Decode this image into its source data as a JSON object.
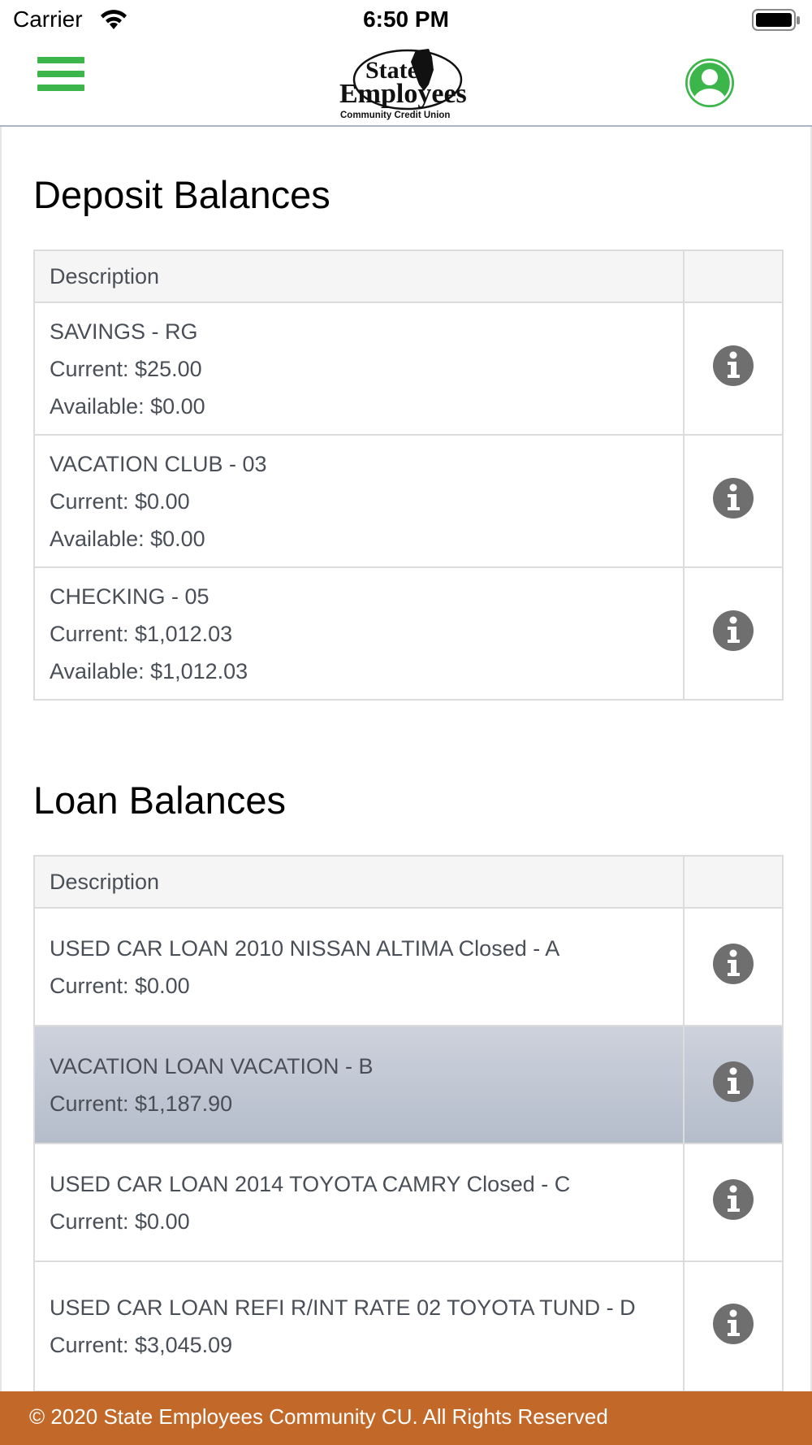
{
  "status_bar": {
    "carrier": "Carrier",
    "time": "6:50 PM"
  },
  "header": {
    "logo": {
      "line1": "State",
      "line2": "Employees",
      "line3": "Community Credit Union"
    },
    "menu_icon": "hamburger-icon",
    "profile_icon": "user-icon",
    "accent_color": "#3cb54a"
  },
  "deposit": {
    "title": "Deposit Balances",
    "column_header": "Description",
    "rows": [
      {
        "name": "SAVINGS - RG",
        "current": "Current: $25.00",
        "available": "Available: $0.00"
      },
      {
        "name": "VACATION CLUB - 03",
        "current": "Current: $0.00",
        "available": "Available: $0.00"
      },
      {
        "name": "CHECKING - 05",
        "current": "Current: $1,012.03",
        "available": "Available: $1,012.03"
      }
    ]
  },
  "loan": {
    "title": "Loan Balances",
    "column_header": "Description",
    "rows": [
      {
        "name": "USED CAR LOAN 2010 NISSAN ALTIMA Closed - A",
        "current": "Current: $0.00"
      },
      {
        "name": "VACATION LOAN VACATION - B",
        "current": "Current: $1,187.90"
      },
      {
        "name": "USED CAR LOAN 2014 TOYOTA CAMRY Closed - C",
        "current": "Current: $0.00"
      },
      {
        "name": "USED CAR LOAN REFI R/INT RATE 02 TOYOTA TUND - D",
        "current": "Current: $3,045.09"
      }
    ]
  },
  "footer": {
    "text": "© 2020 State Employees Community CU. All Rights Reserved",
    "color": "#c2692a"
  }
}
